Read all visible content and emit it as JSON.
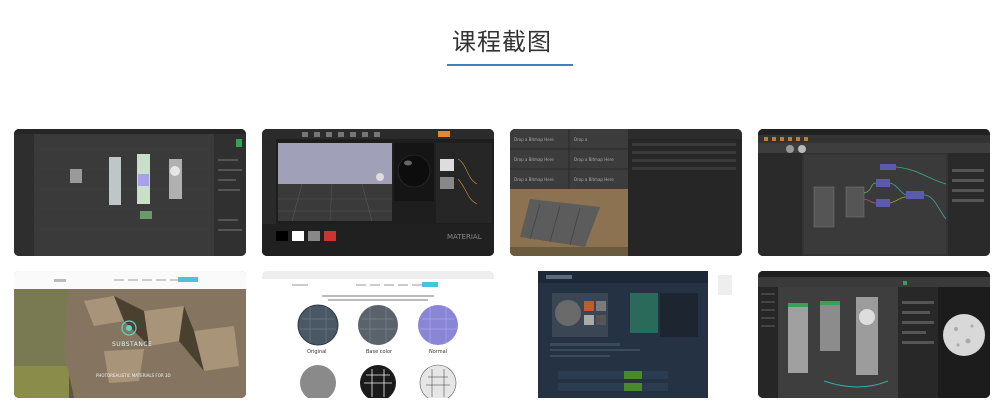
{
  "section": {
    "title": "课程截图"
  },
  "colors": {
    "accent": "#3b82c4",
    "title": "#333333"
  },
  "screenshots": [
    {
      "subject": "node-graph-editor-dark"
    },
    {
      "subject": "unreal-material-editor"
    },
    {
      "subject": "drop-bitmap-panels-ground-texture"
    },
    {
      "subject": "substance-node-graph-colored-links"
    },
    {
      "subject": "substance-landing-rock",
      "brand": "SUBSTANCE",
      "caption": "PHOTOREALISTIC MATERIALS FOR 3D"
    },
    {
      "subject": "material-sphere-previews",
      "labels": [
        "Original",
        "Base color",
        "Normal"
      ]
    },
    {
      "subject": "dark-web-material-page"
    },
    {
      "subject": "sphere-material-node-graph"
    }
  ]
}
